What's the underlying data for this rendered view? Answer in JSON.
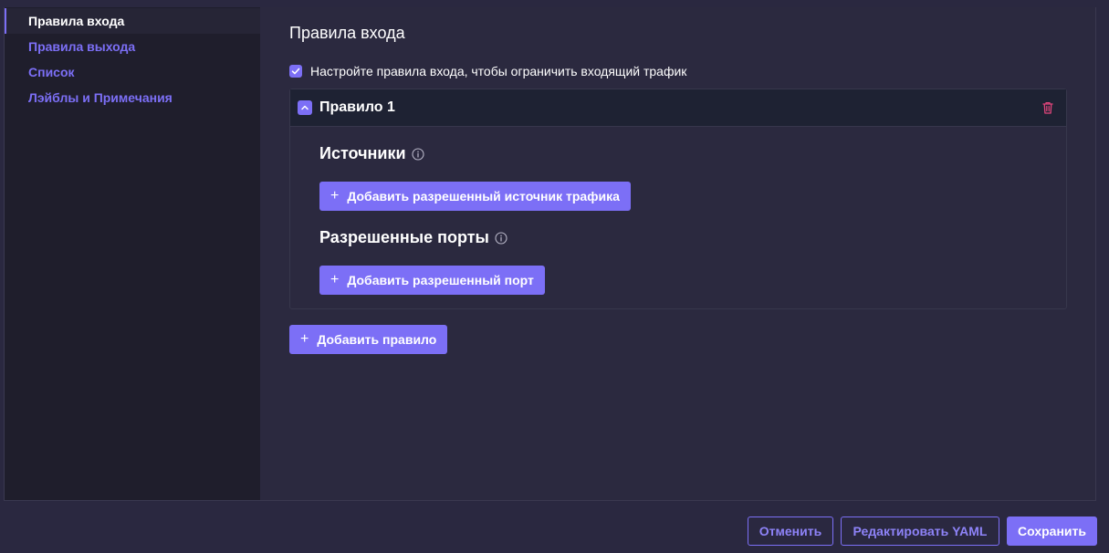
{
  "sidebar": {
    "items": [
      {
        "label": "Правила входа",
        "active": true
      },
      {
        "label": "Правила выхода",
        "active": false
      },
      {
        "label": "Список",
        "active": false
      },
      {
        "label": "Лэйблы и Примечания",
        "active": false
      }
    ]
  },
  "main": {
    "title": "Правила входа",
    "checkbox": {
      "label": "Настройте правила входа, чтобы ограничить входящий трафик",
      "checked": true
    },
    "rule": {
      "title": "Правило 1",
      "sources_title": "Источники",
      "add_source_label": "Добавить разрешенный источник трафика",
      "ports_title": "Разрешенные порты",
      "add_port_label": "Добавить разрешенный порт"
    },
    "add_rule_label": "Добавить правило"
  },
  "footer": {
    "cancel_label": "Отменить",
    "edit_yaml_label": "Редактировать YAML",
    "save_label": "Сохранить"
  },
  "colors": {
    "accent": "#7c6ff6",
    "background": "#2b293f",
    "sidebar_background": "#1f1e2c",
    "danger": "#e0457b"
  },
  "icons": {
    "plus": "plus-icon",
    "info": "info-icon",
    "collapse": "chevron-up-icon",
    "delete": "trash-icon",
    "check": "check-icon"
  }
}
